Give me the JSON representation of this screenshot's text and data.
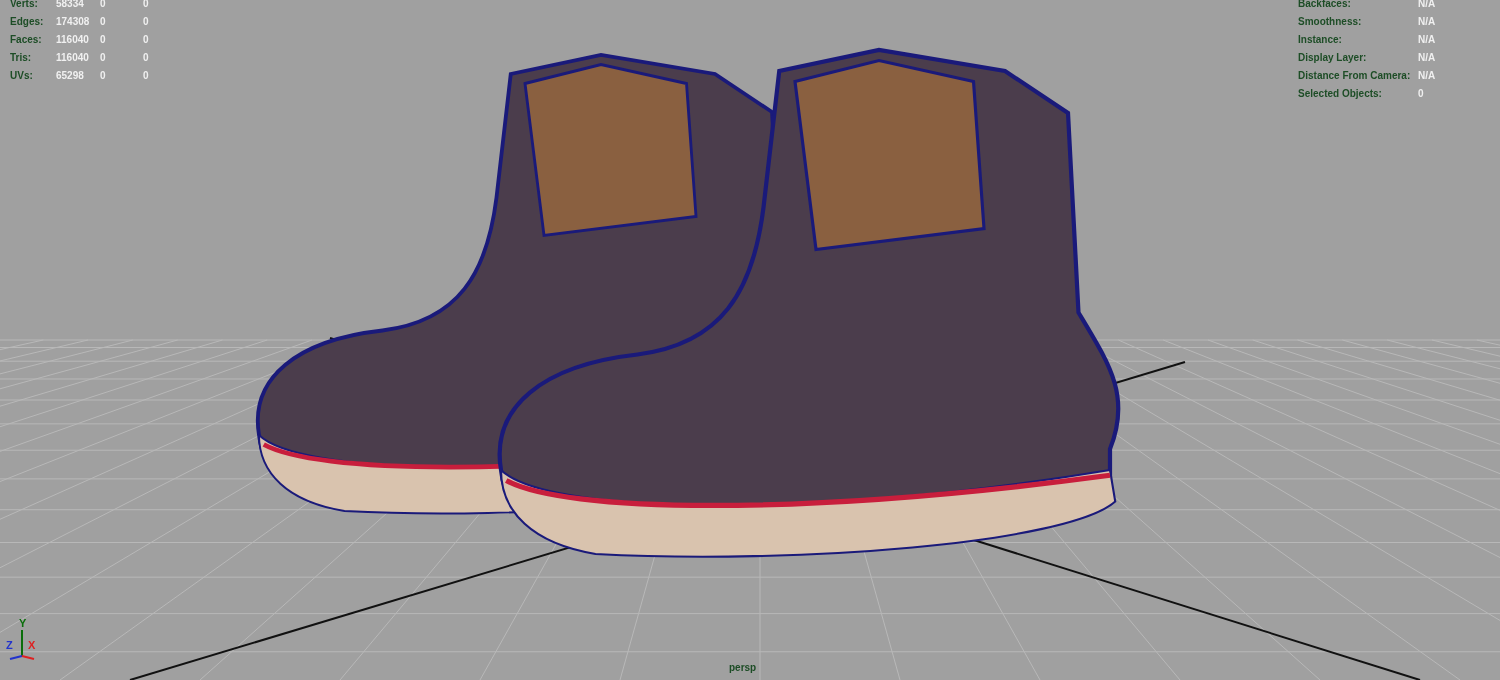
{
  "hud_left": {
    "rows": [
      {
        "label": "Verts:",
        "values": [
          "58334",
          "0",
          "0"
        ]
      },
      {
        "label": "Edges:",
        "values": [
          "174308",
          "0",
          "0"
        ]
      },
      {
        "label": "Faces:",
        "values": [
          "116040",
          "0",
          "0"
        ]
      },
      {
        "label": "Tris:",
        "values": [
          "116040",
          "0",
          "0"
        ]
      },
      {
        "label": "UVs:",
        "values": [
          "65298",
          "0",
          "0"
        ]
      }
    ]
  },
  "hud_right": {
    "rows": [
      {
        "label": "Backfaces:",
        "value": "N/A"
      },
      {
        "label": "Smoothness:",
        "value": "N/A"
      },
      {
        "label": "Instance:",
        "value": "N/A"
      },
      {
        "label": "Display Layer:",
        "value": "N/A"
      },
      {
        "label": "Distance From Camera:",
        "value": "N/A"
      },
      {
        "label": "Selected Objects:",
        "value": "0"
      }
    ]
  },
  "axis_gizmo": {
    "axes": [
      {
        "label": "Y",
        "color": "#0a6e0a"
      },
      {
        "label": "Z",
        "color": "#2233cc"
      },
      {
        "label": "X",
        "color": "#dd2222"
      }
    ]
  },
  "camera_label": "persp"
}
